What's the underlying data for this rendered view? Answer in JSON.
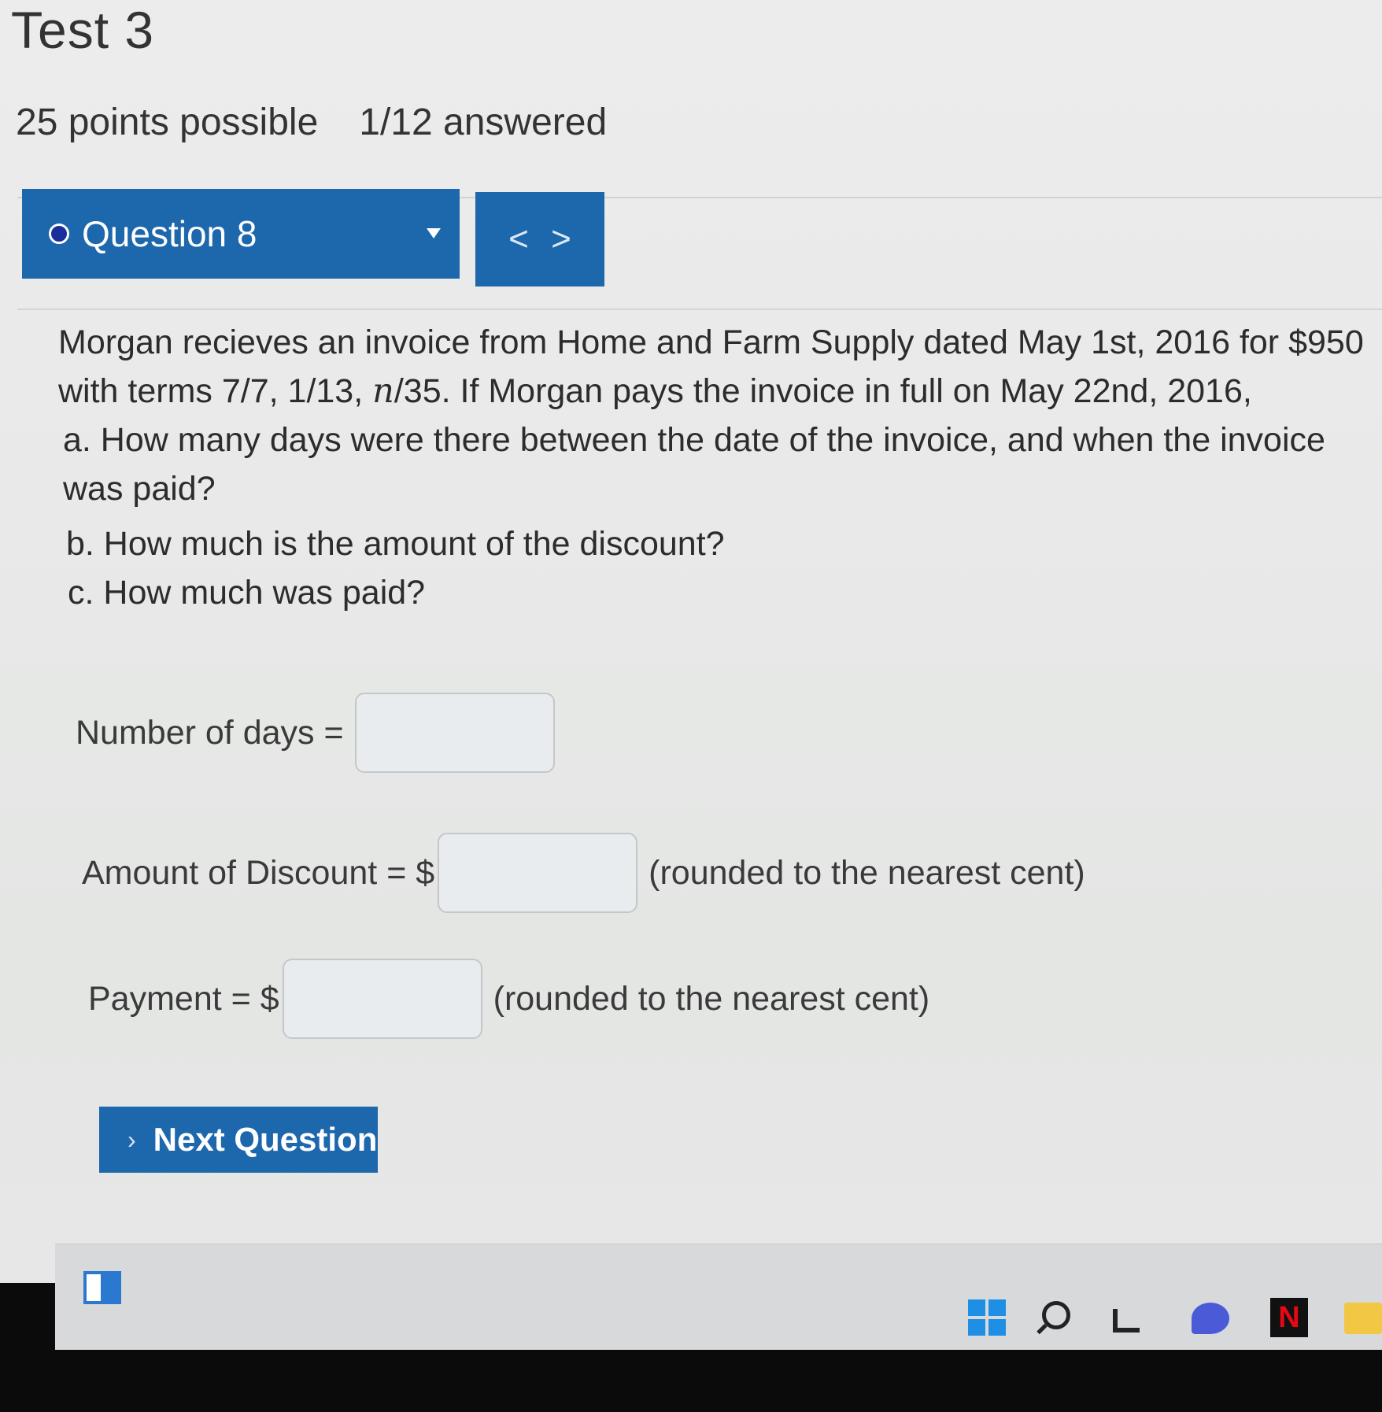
{
  "page": {
    "title": "Test 3",
    "points_possible": "25 points possible",
    "answered": "1/12 answered"
  },
  "question_nav": {
    "current_label": "Question 8",
    "prev_glyph": "<",
    "next_glyph": ">"
  },
  "question": {
    "intro_line1": "Morgan recieves an invoice from Home and Farm Supply dated May 1st, 2016 for $950",
    "intro_line2_pre": "with terms 7/7, 1/13, ",
    "intro_line2_var": "n",
    "intro_line2_post": "/35. If Morgan pays the invoice in full on May 22nd, 2016,",
    "part_a": "a. How many days were there between the date of the invoice, and when the invoice was paid?",
    "part_b": "b. How much is the amount of the discount?",
    "part_c": "c. How much was paid?"
  },
  "fields": {
    "days_label": "Number of days =",
    "days_value": "",
    "discount_label": "Amount of Discount = $",
    "discount_value": "",
    "discount_hint": "(rounded to the nearest cent)",
    "payment_label": "Payment = $",
    "payment_value": "",
    "payment_hint": "(rounded to the nearest cent)"
  },
  "actions": {
    "next_question_label": "Next Question",
    "next_chevron": "›"
  },
  "taskbar": {
    "icons": [
      "widgets-icon",
      "windows-start-icon",
      "search-icon",
      "task-view-icon",
      "chat-icon",
      "netflix-icon",
      "file-explorer-icon"
    ],
    "netflix_letter": "N"
  },
  "colors": {
    "primary_blue": "#1d67ad",
    "status_dot": "#1a2f9a",
    "page_bg": "#ececec"
  }
}
